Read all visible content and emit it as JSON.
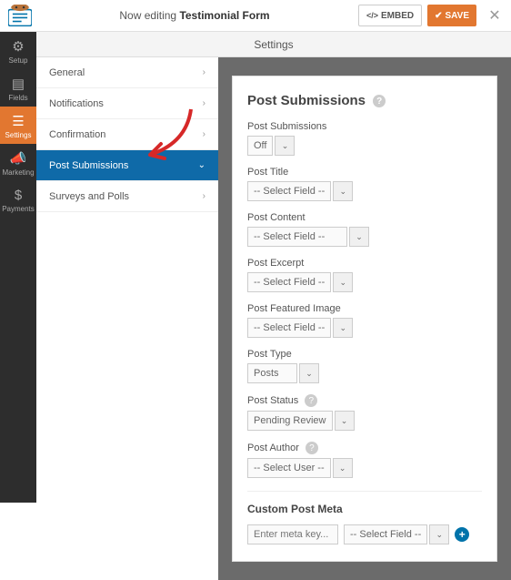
{
  "header": {
    "editing_prefix": "Now editing",
    "form_name": "Testimonial Form",
    "embed_label": "EMBED",
    "save_label": "SAVE",
    "subheader": "Settings"
  },
  "leftnav": {
    "items": [
      {
        "label": "Setup"
      },
      {
        "label": "Fields"
      },
      {
        "label": "Settings"
      },
      {
        "label": "Marketing"
      },
      {
        "label": "Payments"
      }
    ]
  },
  "sidepanel": {
    "items": [
      {
        "label": "General"
      },
      {
        "label": "Notifications"
      },
      {
        "label": "Confirmation"
      },
      {
        "label": "Post Submissions"
      },
      {
        "label": "Surveys and Polls"
      }
    ]
  },
  "settings": {
    "title": "Post Submissions",
    "fields": {
      "post_submissions": {
        "label": "Post Submissions",
        "value": "Off"
      },
      "post_title": {
        "label": "Post Title",
        "value": "-- Select Field --"
      },
      "post_content": {
        "label": "Post Content",
        "value": "-- Select Field --"
      },
      "post_excerpt": {
        "label": "Post Excerpt",
        "value": "-- Select Field --"
      },
      "post_featured_image": {
        "label": "Post Featured Image",
        "value": "-- Select Field --"
      },
      "post_type": {
        "label": "Post Type",
        "value": "Posts"
      },
      "post_status": {
        "label": "Post Status",
        "value": "Pending Review"
      },
      "post_author": {
        "label": "Post Author",
        "value": "-- Select User --"
      }
    },
    "meta": {
      "title": "Custom Post Meta",
      "key_placeholder": "Enter meta key...",
      "field_value": "-- Select Field --"
    }
  }
}
